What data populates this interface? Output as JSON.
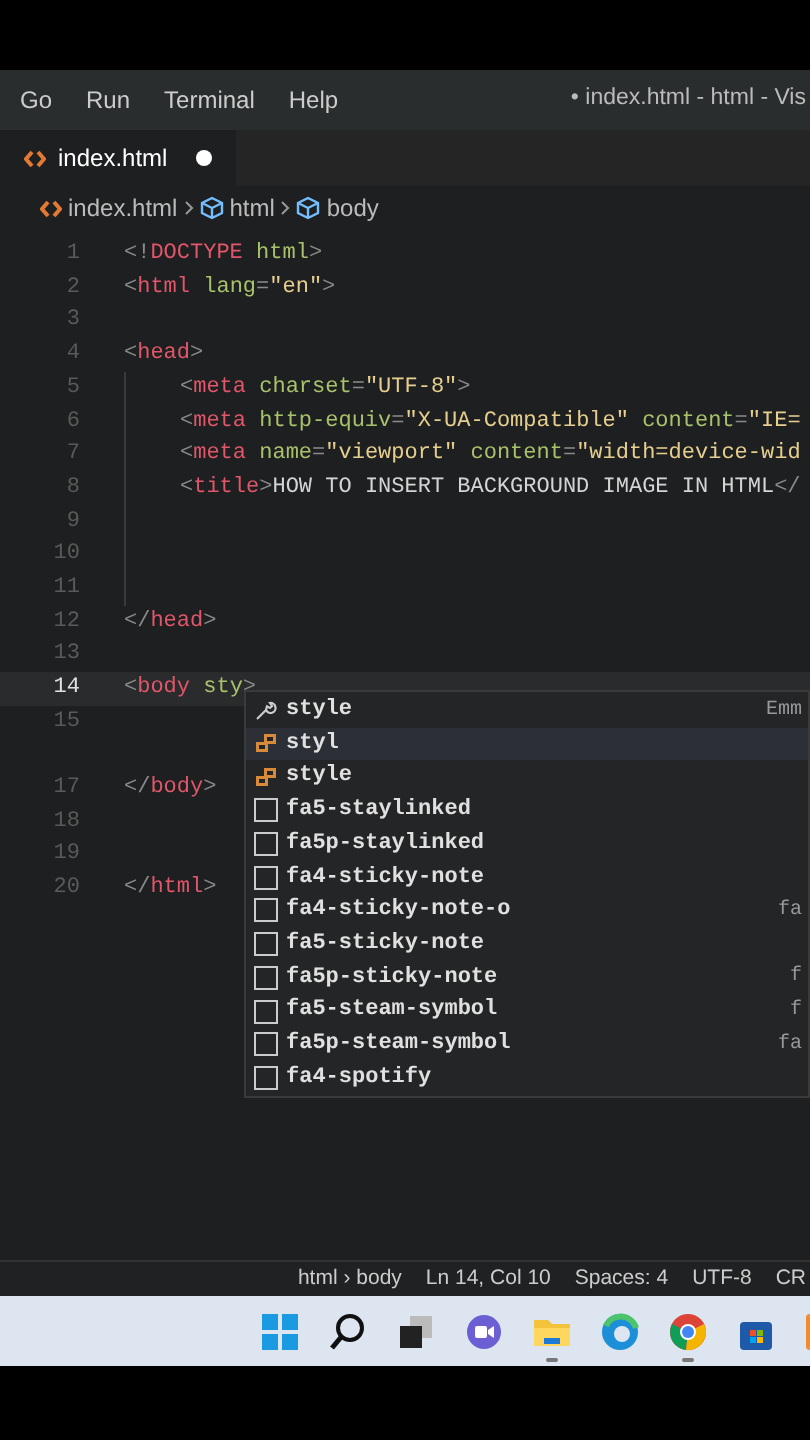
{
  "menu": [
    "Go",
    "Run",
    "Terminal",
    "Help"
  ],
  "window": {
    "title": "• index.html - html - Vis"
  },
  "tabs": [
    {
      "label": "index.html",
      "selected": true,
      "modified": true
    }
  ],
  "breadcrumbs": [
    {
      "label": "index.html",
      "kind": "file"
    },
    {
      "label": "html",
      "kind": "element"
    },
    {
      "label": "body",
      "kind": "element"
    }
  ],
  "editor": {
    "lines": [
      {
        "number": "1",
        "current": false,
        "tokens": [
          {
            "t": "<!",
            "kind": "punct"
          },
          {
            "t": "DOCTYPE",
            "kind": "tag"
          },
          {
            "t": " html",
            "kind": "attr"
          },
          {
            "t": ">",
            "kind": "punct"
          }
        ]
      },
      {
        "number": "2",
        "current": false,
        "tokens": [
          {
            "t": "<",
            "kind": "punct"
          },
          {
            "t": "html",
            "kind": "tag"
          },
          {
            "t": " lang",
            "kind": "attr"
          },
          {
            "t": "=",
            "kind": "punct"
          },
          {
            "t": "\"en\"",
            "kind": "string"
          },
          {
            "t": ">",
            "kind": "punct"
          }
        ]
      },
      {
        "number": "3",
        "current": false
      },
      {
        "number": "4",
        "current": false,
        "tokens": [
          {
            "t": "<",
            "kind": "punct"
          },
          {
            "t": "head",
            "kind": "tag"
          },
          {
            "t": ">",
            "kind": "punct"
          }
        ],
        "children": [
          {
            "number": "5",
            "current": false,
            "tokens": [
              {
                "t": "<",
                "kind": "punct"
              },
              {
                "t": "meta",
                "kind": "tag"
              },
              {
                "t": " charset",
                "kind": "attr"
              },
              {
                "t": "=",
                "kind": "punct"
              },
              {
                "t": "\"UTF-8\"",
                "kind": "string"
              },
              {
                "t": ">",
                "kind": "punct"
              }
            ]
          },
          {
            "number": "6",
            "current": false,
            "tokens": [
              {
                "t": "<",
                "kind": "punct"
              },
              {
                "t": "meta",
                "kind": "tag"
              },
              {
                "t": " http-equiv",
                "kind": "attr"
              },
              {
                "t": "=",
                "kind": "punct"
              },
              {
                "t": "\"X-UA-Compatible\"",
                "kind": "string"
              },
              {
                "t": " content",
                "kind": "attr"
              },
              {
                "t": "=",
                "kind": "punct"
              },
              {
                "t": "\"IE=",
                "kind": "string"
              }
            ]
          },
          {
            "number": "7",
            "current": false,
            "tokens": [
              {
                "t": "<",
                "kind": "punct"
              },
              {
                "t": "meta",
                "kind": "tag"
              },
              {
                "t": " name",
                "kind": "attr"
              },
              {
                "t": "=",
                "kind": "punct"
              },
              {
                "t": "\"viewport\"",
                "kind": "string"
              },
              {
                "t": " content",
                "kind": "attr"
              },
              {
                "t": "=",
                "kind": "punct"
              },
              {
                "t": "\"width=device-wid",
                "kind": "string"
              }
            ]
          },
          {
            "number": "8",
            "current": false,
            "tokens": [
              {
                "t": "<",
                "kind": "punct"
              },
              {
                "t": "title",
                "kind": "tag"
              },
              {
                "t": ">",
                "kind": "punct"
              },
              {
                "t": "HOW TO INSERT BACKGROUND IMAGE IN HTML",
                "kind": "text"
              },
              {
                "t": "</",
                "kind": "punct"
              }
            ]
          },
          {
            "number": "9",
            "current": false
          },
          {
            "number": "10",
            "current": false
          },
          {
            "number": "11",
            "current": false
          }
        ]
      },
      {
        "number": "12",
        "current": false,
        "tokens": [
          {
            "t": "</",
            "kind": "punct"
          },
          {
            "t": "head",
            "kind": "tag"
          },
          {
            "t": ">",
            "kind": "punct"
          }
        ]
      },
      {
        "number": "13",
        "current": false
      },
      {
        "number": "14",
        "current": true,
        "tokens": [
          {
            "t": "<",
            "kind": "punct"
          },
          {
            "t": "body",
            "kind": "tag"
          },
          {
            "t": " sty",
            "kind": "attr"
          },
          {
            "t": ">",
            "kind": "punct"
          }
        ]
      },
      {
        "number": "15",
        "current": false
      },
      {
        "current": false
      },
      {
        "number": "17",
        "current": false,
        "tokens": [
          {
            "t": "</",
            "kind": "punct"
          },
          {
            "t": "body",
            "kind": "tag"
          },
          {
            "t": ">",
            "kind": "punct"
          }
        ]
      },
      {
        "number": "18",
        "current": false
      },
      {
        "number": "19",
        "current": false
      },
      {
        "number": "20",
        "current": false,
        "tokens": [
          {
            "t": "</",
            "kind": "punct"
          },
          {
            "t": "html",
            "kind": "tag"
          },
          {
            "t": ">",
            "kind": "punct"
          }
        ]
      }
    ]
  },
  "suggestions": [
    {
      "label": "style",
      "kind": "snippet",
      "selected": false,
      "detail": "Emm"
    },
    {
      "label": "styl",
      "kind": "property",
      "selected": true
    },
    {
      "label": "style",
      "kind": "property",
      "selected": false
    },
    {
      "label": "fa5-staylinked",
      "kind": "square",
      "selected": false
    },
    {
      "label": "fa5p-staylinked",
      "kind": "square",
      "selected": false
    },
    {
      "label": "fa4-sticky-note",
      "kind": "square",
      "selected": false
    },
    {
      "label": "fa4-sticky-note-o",
      "kind": "square",
      "selected": false,
      "detail": "fa"
    },
    {
      "label": "fa5-sticky-note",
      "kind": "square",
      "selected": false
    },
    {
      "label": "fa5p-sticky-note",
      "kind": "square",
      "selected": false,
      "detail": "f"
    },
    {
      "label": "fa5-steam-symbol",
      "kind": "square",
      "selected": false,
      "detail": "f"
    },
    {
      "label": "fa5p-steam-symbol",
      "kind": "square",
      "selected": false,
      "detail": "fa"
    },
    {
      "label": "fa4-spotify",
      "kind": "square",
      "selected": false
    }
  ],
  "status_bar": [
    "html › body",
    "Ln 14, Col 10",
    "Spaces: 4",
    "UTF-8",
    "CR"
  ],
  "taskbar": [
    {
      "kind": "start"
    },
    {
      "kind": "search"
    },
    {
      "kind": "taskview"
    },
    {
      "kind": "chat"
    },
    {
      "kind": "folder",
      "running": true
    },
    {
      "kind": "edge",
      "running": false
    },
    {
      "kind": "chrome",
      "running": true
    },
    {
      "kind": "store",
      "running": false
    },
    {
      "kind": "xampp",
      "running": false
    }
  ]
}
